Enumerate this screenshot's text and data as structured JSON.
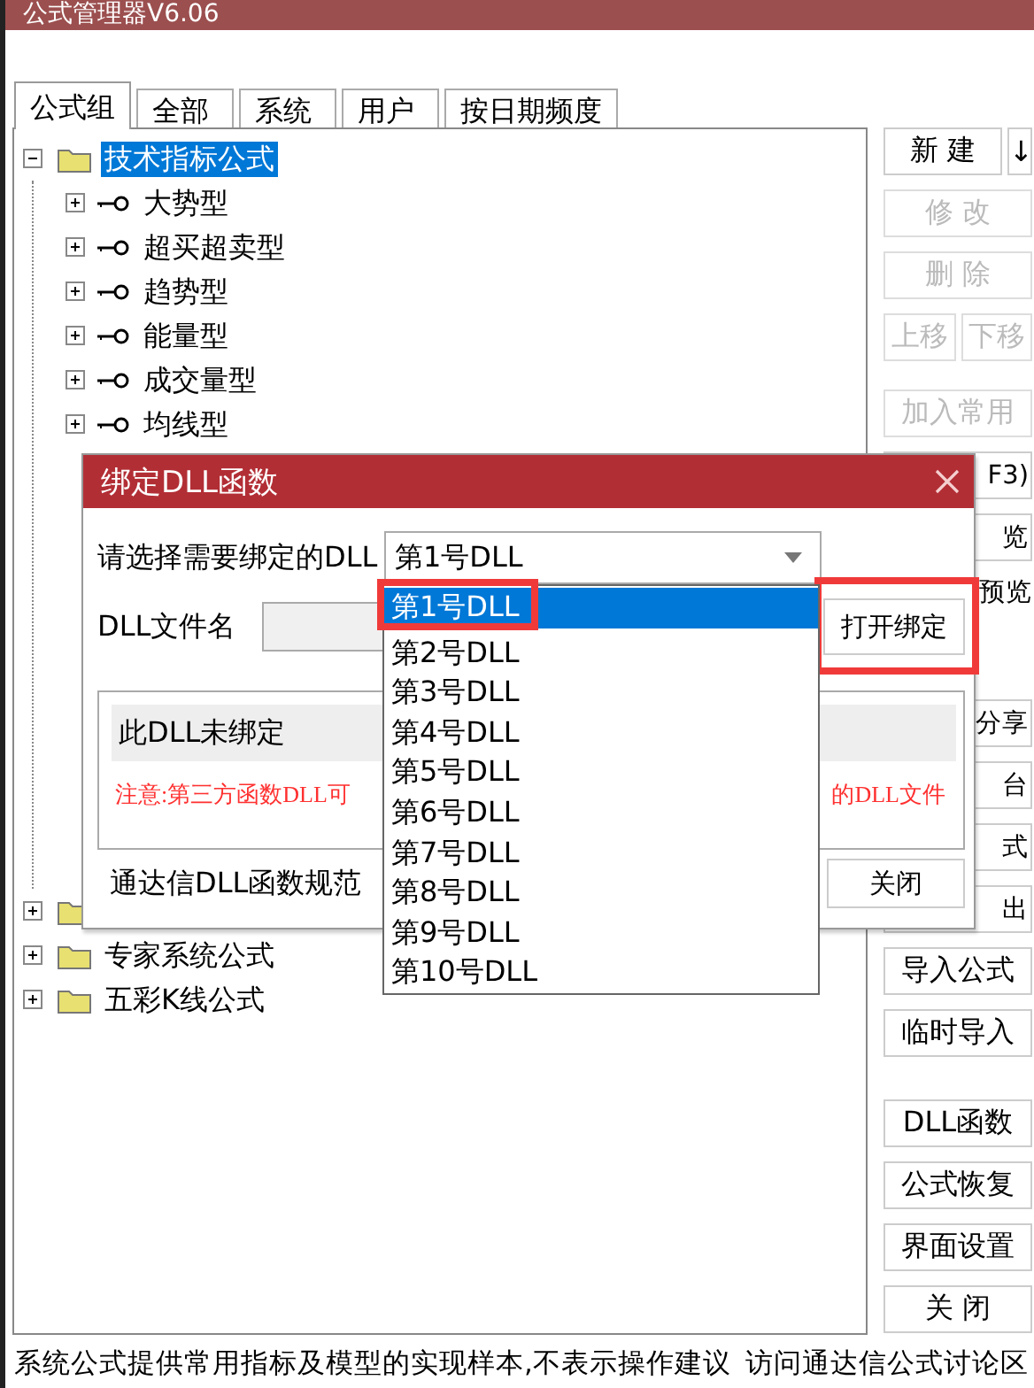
{
  "window": {
    "title": "公式管理器V6.06"
  },
  "tabs": [
    {
      "label": "公式组",
      "selected": true
    },
    {
      "label": "全部",
      "selected": false
    },
    {
      "label": "系统",
      "selected": false
    },
    {
      "label": "用户",
      "selected": false
    },
    {
      "label": "按日期频度",
      "selected": false
    }
  ],
  "tree": {
    "top": [
      {
        "label": "技术指标公式",
        "expanded": true,
        "selected": true,
        "children": [
          {
            "label": "大势型",
            "expanded": false,
            "selected": false
          },
          {
            "label": "超买超卖型",
            "expanded": false,
            "selected": false
          },
          {
            "label": "趋势型",
            "expanded": false,
            "selected": false
          },
          {
            "label": "能量型",
            "expanded": false,
            "selected": false
          },
          {
            "label": "成交量型",
            "expanded": false,
            "selected": false
          },
          {
            "label": "均线型",
            "expanded": false,
            "selected": false
          }
        ]
      }
    ],
    "bottom": [
      {
        "label": "专家系统公式",
        "expanded": false,
        "selected": false
      },
      {
        "label": "五彩K线公式",
        "expanded": false,
        "selected": false
      }
    ]
  },
  "button_groups": [
    [
      {
        "kind": "split",
        "buttons": [
          {
            "label": "新 建",
            "disabled": false
          },
          {
            "label": "↓",
            "disabled": false
          }
        ]
      },
      {
        "kind": "button",
        "label": "修 改",
        "disabled": true
      },
      {
        "kind": "button",
        "label": "删 除",
        "disabled": true
      },
      {
        "kind": "split",
        "buttons": [
          {
            "label": "上移",
            "disabled": true
          },
          {
            "label": "下移",
            "disabled": true
          }
        ]
      },
      {
        "kind": "button",
        "label": "加入常用",
        "disabled": true
      },
      {
        "kind": "covered",
        "label": "F3)",
        "disabled": false
      },
      {
        "kind": "covered",
        "label": "览",
        "disabled": false
      },
      {
        "kind": "covered-text",
        "label": "预览"
      }
    ],
    [
      {
        "kind": "covered",
        "label": "分享",
        "disabled": false
      },
      {
        "kind": "covered",
        "label": "台",
        "disabled": false
      },
      {
        "kind": "covered",
        "label": "式",
        "disabled": false
      },
      {
        "kind": "covered",
        "label": "出",
        "disabled": false
      },
      {
        "kind": "button",
        "label": "导入公式",
        "disabled": false
      },
      {
        "kind": "button",
        "label": "临时导入",
        "disabled": false
      }
    ],
    [
      {
        "kind": "button",
        "label": "DLL函数",
        "disabled": false
      },
      {
        "kind": "button",
        "label": "公式恢复",
        "disabled": false
      },
      {
        "kind": "button",
        "label": "界面设置",
        "disabled": false
      },
      {
        "kind": "button",
        "label": "关 闭",
        "disabled": false
      }
    ]
  ],
  "status_bar": {
    "note": "系统公式提供常用指标及模型的实现样本,不表示操作建议",
    "link": "访问通达信公式讨论区"
  },
  "dialog": {
    "title": "绑定DLL函数",
    "select_label": "请选择需要绑定的DLL",
    "select_value": "第1号DLL",
    "file_label": "DLL文件名",
    "open_button": "打开绑定",
    "status": "此DLL未绑定",
    "note_start": "注意:第三方函数DLL可",
    "note_end": "的DLL文件",
    "spec_link": "通达信DLL函数规范",
    "close_button": "关闭",
    "options": [
      {
        "label": "第1号DLL",
        "selected": true
      },
      {
        "label": "第2号DLL",
        "selected": false
      },
      {
        "label": "第3号DLL",
        "selected": false
      },
      {
        "label": "第4号DLL",
        "selected": false
      },
      {
        "label": "第5号DLL",
        "selected": false
      },
      {
        "label": "第6号DLL",
        "selected": false
      },
      {
        "label": "第7号DLL",
        "selected": false
      },
      {
        "label": "第8号DLL",
        "selected": false
      },
      {
        "label": "第9号DLL",
        "selected": false
      },
      {
        "label": "第10号DLL",
        "selected": false
      }
    ]
  }
}
